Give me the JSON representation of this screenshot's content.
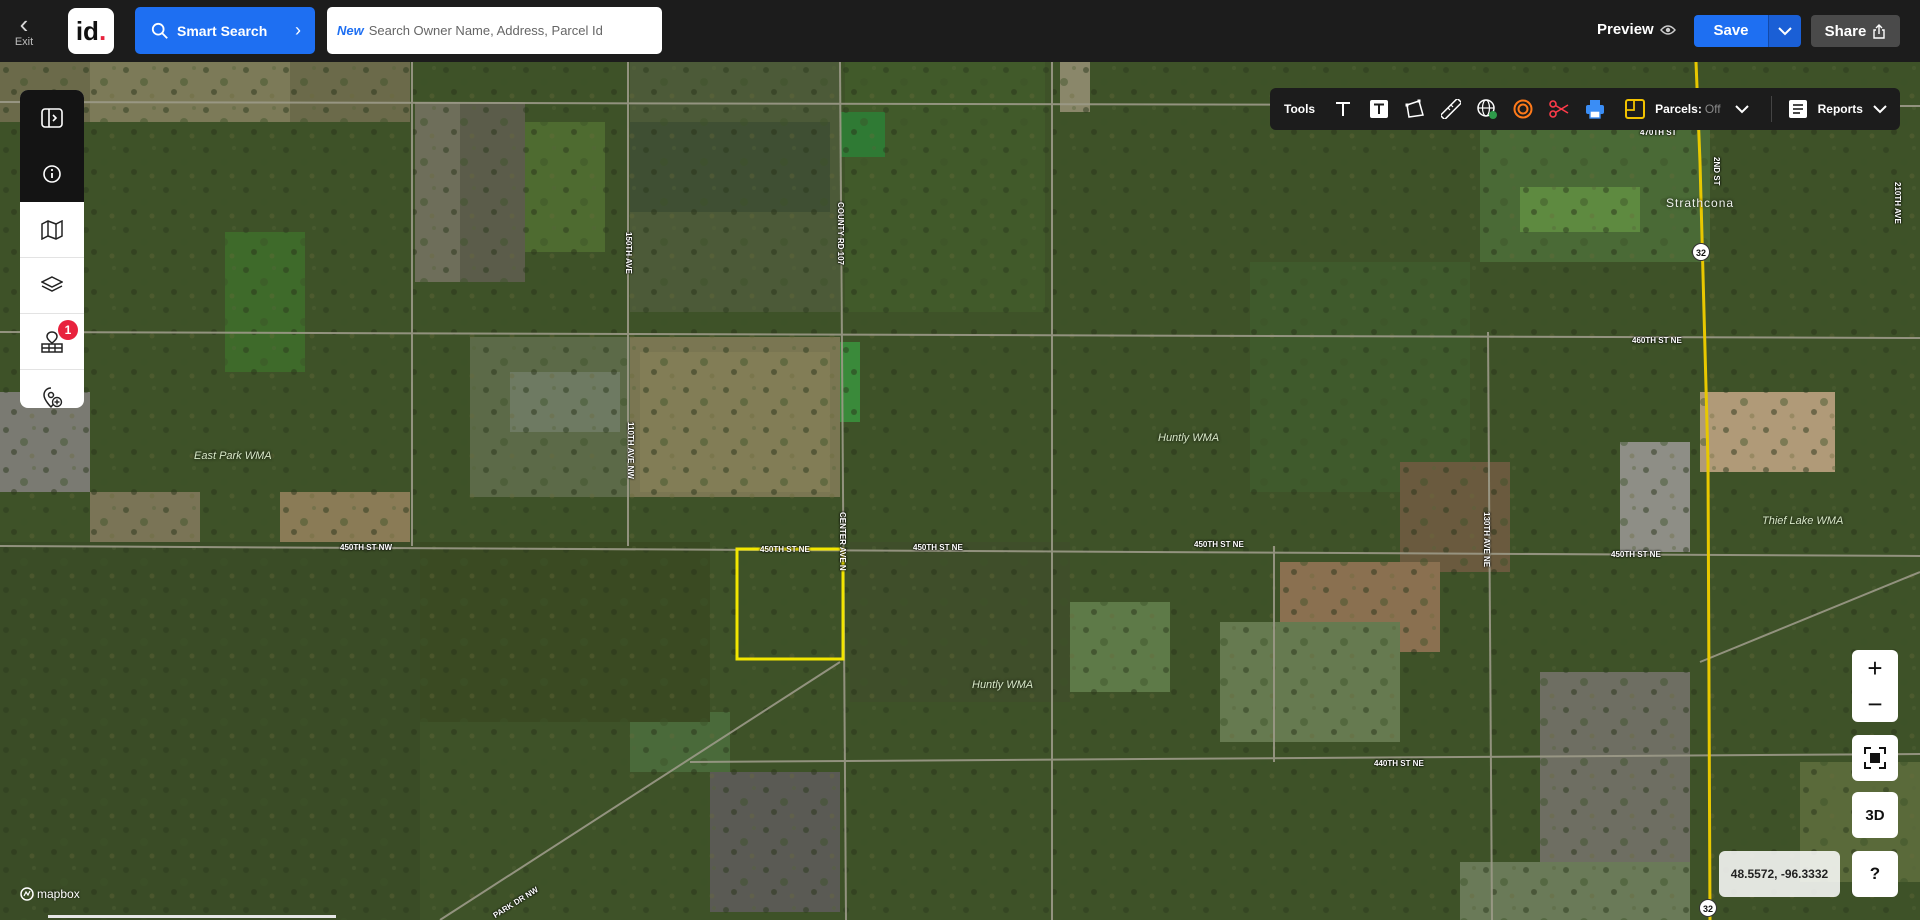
{
  "topbar": {
    "exit_label": "Exit",
    "logo_text": "id",
    "smart_search_label": "Smart Search",
    "search_new_tag": "New",
    "search_placeholder": "Search Owner Name, Address, Parcel Id",
    "preview_label": "Preview",
    "save_label": "Save",
    "share_label": "Share"
  },
  "sidebar": {
    "items": [
      {
        "icon": "panel-toggle-icon"
      },
      {
        "icon": "info-icon"
      },
      {
        "icon": "map-icon"
      },
      {
        "icon": "layers-icon"
      },
      {
        "icon": "parcels-icon",
        "badge": "1"
      },
      {
        "icon": "add-location-icon"
      }
    ]
  },
  "tools": {
    "label": "Tools",
    "icons": [
      "text-icon",
      "text-box-icon",
      "polygon-icon",
      "ruler-icon",
      "globe-icon",
      "buffer-icon",
      "scissors-icon",
      "print-icon"
    ],
    "parcels_label": "Parcels:",
    "parcels_value": "Off",
    "reports_label": "Reports"
  },
  "map": {
    "roads": {
      "h_450_w": "450TH ST NW",
      "h_450_sel": "450TH ST NE",
      "h_450_e1": "450TH ST NE",
      "h_450_e2": "450TH ST NE",
      "h_450_e3": "450TH ST NE",
      "h_460": "460TH ST NE",
      "h_440": "440TH ST NE",
      "h_470": "470TH ST",
      "v_150": "150TH AVE",
      "v_110": "110TH AVE NW",
      "v_county": "COUNTY RD 107",
      "v_center": "CENTER AVE N",
      "v_130": "130TH AVE NE",
      "v_2nd": "2ND ST",
      "v_210": "210TH AVE",
      "diag": "PARK DR NW"
    },
    "areas": {
      "east_park": "East Park WMA",
      "huntly_n": "Huntly WMA",
      "huntly_s": "Huntly WMA",
      "thief_lake": "Thief Lake WMA"
    },
    "town": "Strathcona",
    "shields": [
      "32",
      "32"
    ],
    "selection_color": "#f2e600",
    "attribution": "mapbox"
  },
  "controls": {
    "zoom_in": "+",
    "zoom_out": "−",
    "three_d": "3D",
    "help": "?",
    "coordinates": "48.5572, -96.3332"
  },
  "colors": {
    "accent": "#1e6ff2",
    "badge": "#e8223d",
    "parcel_icon": "#f2c200"
  }
}
